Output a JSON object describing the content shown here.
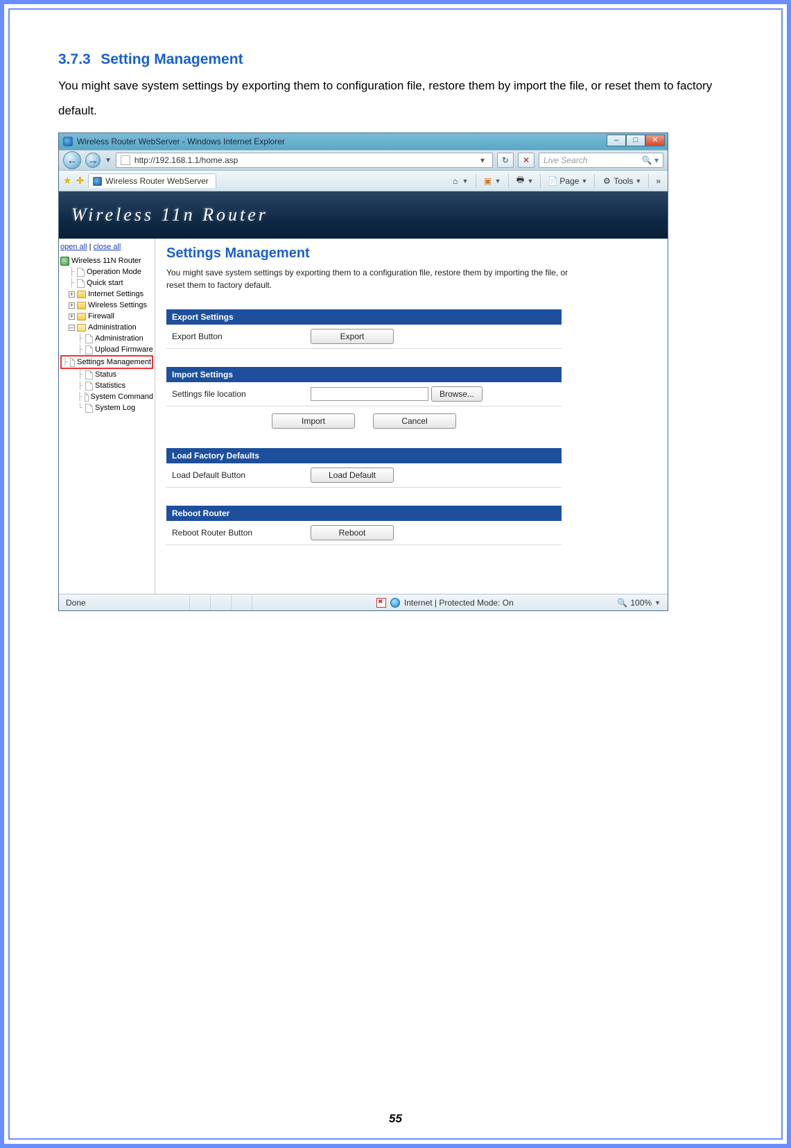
{
  "doc": {
    "section_number": "3.7.3",
    "section_title": "Setting Management",
    "section_text": "You might save system settings by exporting them to configuration file, restore them by import the file, or reset them to factory default.",
    "page_number": "55"
  },
  "ie": {
    "window_title": "Wireless Router WebServer - Windows Internet Explorer",
    "address_url": "http://192.168.1.1/home.asp",
    "search_placeholder": "Live Search",
    "tab_title": "Wireless Router WebServer",
    "cmd_page": "Page",
    "cmd_tools": "Tools",
    "cmd_more": "»",
    "status_left": "Done",
    "status_mid": "Internet | Protected Mode: On",
    "status_zoom": "100%"
  },
  "banner": {
    "text": "Wireless 11n Router"
  },
  "tree": {
    "open_all": "open all",
    "close_all": "close all",
    "root": "Wireless 11N Router",
    "items_level1_pages": [
      "Operation Mode",
      "Quick start"
    ],
    "items_level1_folders": [
      "Internet Settings",
      "Wireless Settings",
      "Firewall"
    ],
    "admin_folder": "Administration",
    "admin_children": [
      "Administration",
      "Upload Firmware",
      "Settings Management",
      "Status",
      "Statistics",
      "System Command",
      "System Log"
    ]
  },
  "content": {
    "title": "Settings Management",
    "desc": "You might save system settings by exporting them to a configuration file, restore them by importing the file, or reset them to factory default.",
    "export": {
      "head": "Export Settings",
      "label": "Export Button",
      "button": "Export"
    },
    "import": {
      "head": "Import Settings",
      "label": "Settings file location",
      "browse": "Browse...",
      "import_btn": "Import",
      "cancel_btn": "Cancel"
    },
    "defaults": {
      "head": "Load Factory Defaults",
      "label": "Load Default Button",
      "button": "Load Default"
    },
    "reboot": {
      "head": "Reboot Router",
      "label": "Reboot Router Button",
      "button": "Reboot"
    }
  }
}
